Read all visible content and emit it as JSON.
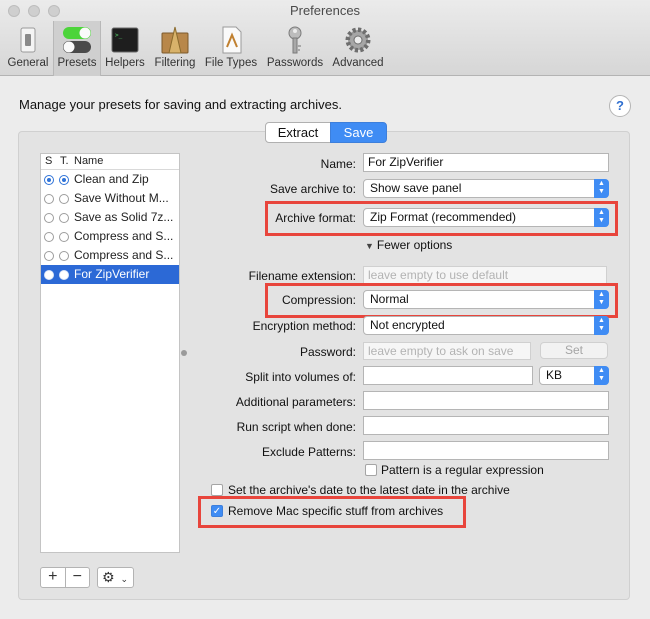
{
  "window": {
    "title": "Preferences"
  },
  "toolbar": {
    "items": [
      {
        "label": "General",
        "icon": "switch-icon"
      },
      {
        "label": "Presets",
        "icon": "toggles-icon"
      },
      {
        "label": "Helpers",
        "icon": "terminal-icon"
      },
      {
        "label": "Filtering",
        "icon": "broom-icon"
      },
      {
        "label": "File Types",
        "icon": "document-icon"
      },
      {
        "label": "Passwords",
        "icon": "key-icon"
      },
      {
        "label": "Advanced",
        "icon": "gear-icon"
      }
    ],
    "active": "Presets"
  },
  "header": {
    "text": "Manage your presets for saving and extracting archives.",
    "help": "?"
  },
  "tabs": {
    "extract": "Extract",
    "save": "Save",
    "selected": "Save"
  },
  "presets": {
    "col_s": "S",
    "col_t": "T.",
    "col_name": "Name",
    "rows": [
      {
        "name": "Clean and Zip",
        "s": true,
        "t": true
      },
      {
        "name": "Save Without M...",
        "s": false,
        "t": false
      },
      {
        "name": "Save as Solid 7z...",
        "s": false,
        "t": false
      },
      {
        "name": "Compress and S...",
        "s": false,
        "t": false
      },
      {
        "name": "Compress and S...",
        "s": false,
        "t": false
      },
      {
        "name": "For ZipVerifier",
        "s": false,
        "t": false,
        "selected": true
      }
    ],
    "add": "+",
    "remove": "−",
    "action": "⚙"
  },
  "form": {
    "name_label": "Name:",
    "name_value": "For ZipVerifier",
    "save_to_label": "Save archive to:",
    "save_to_value": "Show save panel",
    "format_label": "Archive format:",
    "format_value": "Zip Format (recommended)",
    "fewer_options": "Fewer options",
    "ext_label": "Filename extension:",
    "ext_placeholder": "leave empty to use default",
    "compression_label": "Compression:",
    "compression_value": "Normal",
    "encryption_label": "Encryption method:",
    "encryption_value": "Not encrypted",
    "password_label": "Password:",
    "password_placeholder": "leave empty to ask on save",
    "set_button": "Set",
    "split_label": "Split into volumes of:",
    "split_unit": "KB",
    "params_label": "Additional parameters:",
    "script_label": "Run script when done:",
    "exclude_label": "Exclude Patterns:",
    "regex_label": "Pattern is a regular expression",
    "date_label": "Set the archive's date to the latest date in the archive",
    "mac_label": "Remove Mac specific stuff from archives"
  },
  "colors": {
    "accent": "#3f8cf4",
    "highlight": "#e8453c",
    "selection": "#2c69d6"
  }
}
